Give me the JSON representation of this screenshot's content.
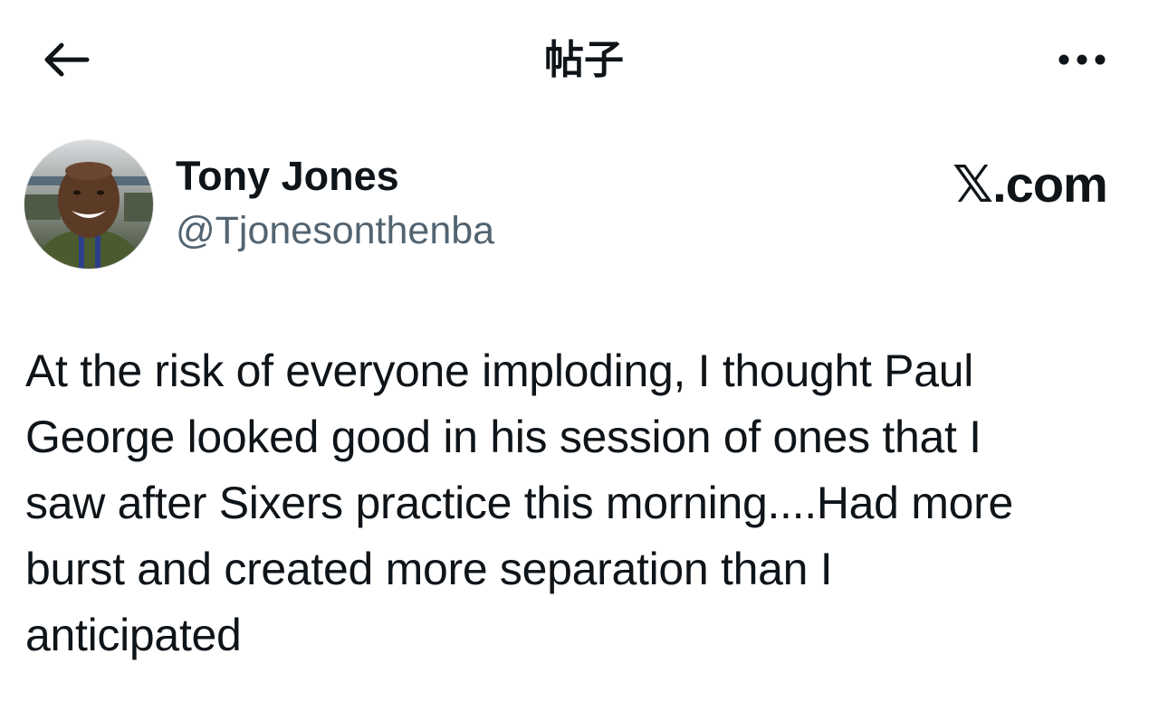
{
  "header": {
    "title": "帖子",
    "back_icon": "arrow-left-icon",
    "more_icon": "more-horizontal-icon"
  },
  "author": {
    "display_name": "Tony Jones",
    "handle": "@Tjonesonthenba",
    "avatar": "profile-photo"
  },
  "source": {
    "brand": "𝕏.com"
  },
  "post": {
    "text": "At the risk of everyone imploding, I thought Paul\nGeorge looked good in his session of ones that I\nsaw after Sixers practice this morning....Had more\nburst and created more separation than I\nanticipated"
  },
  "colors": {
    "text_primary": "#0f1419",
    "text_secondary": "#536471",
    "background": "#ffffff"
  }
}
